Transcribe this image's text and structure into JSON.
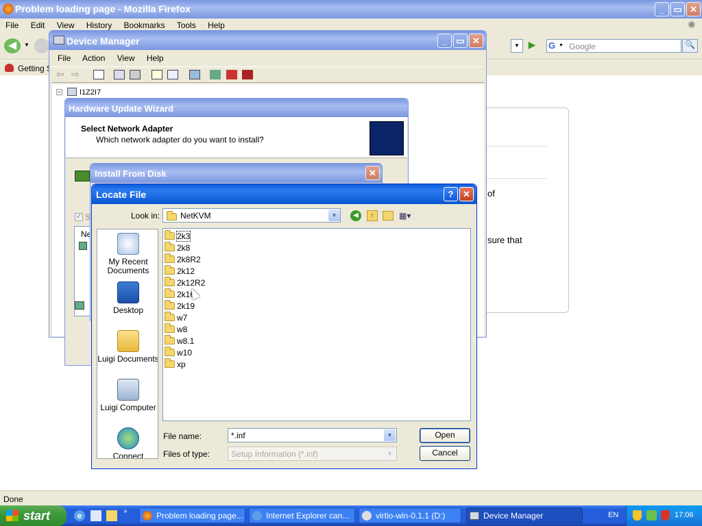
{
  "firefox": {
    "title": "Problem loading page - Mozilla Firefox",
    "menu": [
      "File",
      "Edit",
      "View",
      "History",
      "Bookmarks",
      "Tools",
      "Help"
    ],
    "bookmark": "Getting S",
    "search_placeholder": "Google",
    "status": "Done",
    "page_fragments": [
      "of",
      "sure that"
    ]
  },
  "device_manager": {
    "title": "Device Manager",
    "menu": [
      "File",
      "Action",
      "View",
      "Help"
    ],
    "tree_root": "I1Z2I7"
  },
  "wizard": {
    "title": "Hardware Update Wizard",
    "heading": "Select Network Adapter",
    "subheading": "Which network adapter do you want to install?",
    "fragment_s": "S",
    "fragment_ne": "Ne"
  },
  "install_from_disk": {
    "title": "Install From Disk"
  },
  "locate_file": {
    "title": "Locate File",
    "look_in_label": "Look in:",
    "look_in_value": "NetKVM",
    "places": [
      "My Recent Documents",
      "Desktop",
      "Luigi Documents",
      "Luigi Computer",
      "Connect"
    ],
    "folders": [
      "2k3",
      "2k8",
      "2k8R2",
      "2k12",
      "2k12R2",
      "2k16",
      "2k19",
      "w7",
      "w8",
      "w8.1",
      "w10",
      "xp"
    ],
    "file_name_label": "File name:",
    "file_name_value": "*.inf",
    "file_type_label": "Files of type:",
    "file_type_value": "Setup Information (*.inf)",
    "open_label": "Open",
    "cancel_label": "Cancel"
  },
  "taskbar": {
    "start": "start",
    "buttons": [
      "Problem loading page...",
      "Internet Explorer can...",
      "virtio-win-0.1.1 (D:)",
      "Device Manager"
    ],
    "lang": "EN",
    "time": "17:06"
  }
}
